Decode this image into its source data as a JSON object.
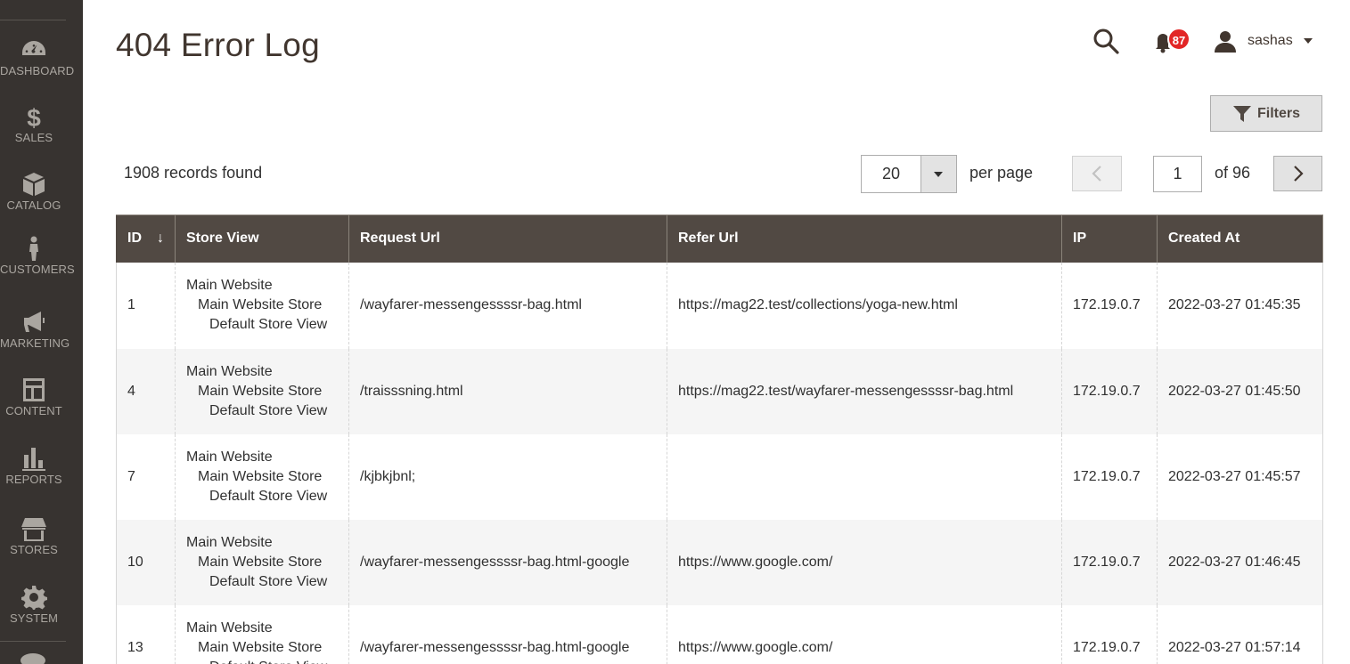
{
  "sidebar": {
    "items": [
      {
        "label": "DASHBOARD",
        "icon": "dashboard-icon"
      },
      {
        "label": "SALES",
        "icon": "dollar-icon"
      },
      {
        "label": "CATALOG",
        "icon": "box-icon"
      },
      {
        "label": "CUSTOMERS",
        "icon": "person-icon"
      },
      {
        "label": "MARKETING",
        "icon": "megaphone-icon"
      },
      {
        "label": "CONTENT",
        "icon": "layout-icon"
      },
      {
        "label": "REPORTS",
        "icon": "bar-chart-icon"
      },
      {
        "label": "STORES",
        "icon": "store-icon"
      },
      {
        "label": "SYSTEM",
        "icon": "gear-icon"
      }
    ]
  },
  "header": {
    "title": "404 Error Log",
    "notifications_count": "87",
    "user_name": "sashas"
  },
  "toolbar": {
    "filters_label": "Filters",
    "records_found": "1908 records found",
    "per_page_value": "20",
    "per_page_label": "per page",
    "current_page": "1",
    "of_pages": "of 96"
  },
  "table": {
    "columns": [
      "ID",
      "Store View",
      "Request Url",
      "Refer Url",
      "IP",
      "Created At"
    ],
    "sort_indicator": "↓",
    "rows": [
      {
        "id": "1",
        "store_view": [
          "Main Website",
          "Main Website Store",
          "Default Store View"
        ],
        "request_url": "/wayfarer-messengessssr-bag.html",
        "refer_url": "https://mag22.test/collections/yoga-new.html",
        "ip": "172.19.0.7",
        "created_at": "2022-03-27 01:45:35"
      },
      {
        "id": "4",
        "store_view": [
          "Main Website",
          "Main Website Store",
          "Default Store View"
        ],
        "request_url": "/traisssning.html",
        "refer_url": "https://mag22.test/wayfarer-messengessssr-bag.html",
        "ip": "172.19.0.7",
        "created_at": "2022-03-27 01:45:50"
      },
      {
        "id": "7",
        "store_view": [
          "Main Website",
          "Main Website Store",
          "Default Store View"
        ],
        "request_url": "/kjbkjbnl;",
        "refer_url": "",
        "ip": "172.19.0.7",
        "created_at": "2022-03-27 01:45:57"
      },
      {
        "id": "10",
        "store_view": [
          "Main Website",
          "Main Website Store",
          "Default Store View"
        ],
        "request_url": "/wayfarer-messengessssr-bag.html-google",
        "refer_url": "https://www.google.com/",
        "ip": "172.19.0.7",
        "created_at": "2022-03-27 01:46:45"
      },
      {
        "id": "13",
        "store_view": [
          "Main Website",
          "Main Website Store",
          "Default Store View"
        ],
        "request_url": "/wayfarer-messengessssr-bag.html-google",
        "refer_url": "https://www.google.com/",
        "ip": "172.19.0.7",
        "created_at": "2022-03-27 01:57:14"
      }
    ]
  }
}
